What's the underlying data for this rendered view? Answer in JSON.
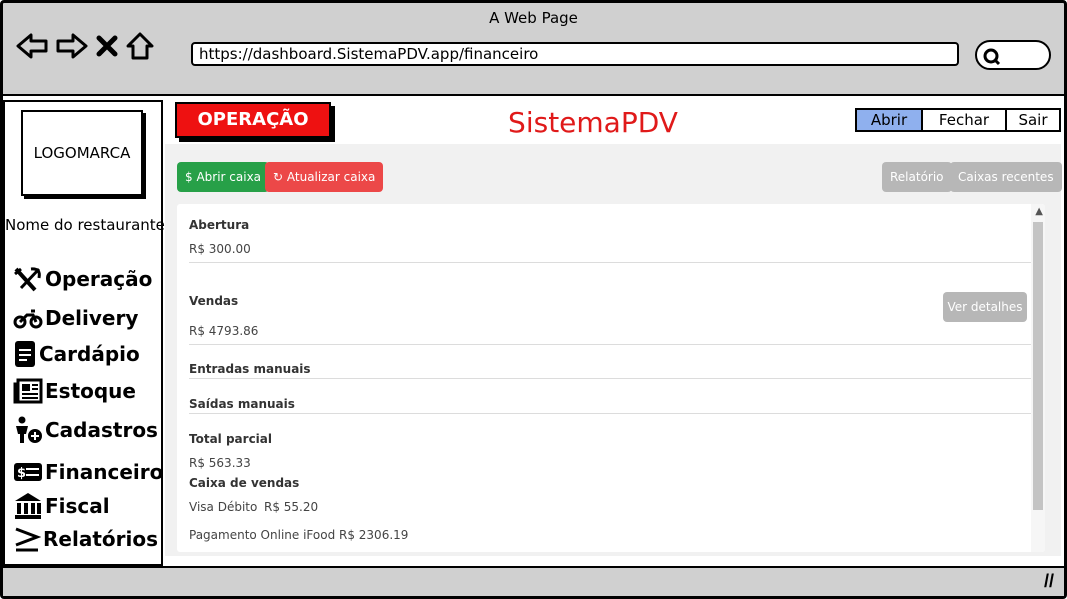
{
  "browser": {
    "title": "A Web Page",
    "url": "https://dashboard.SistemaPDV.app/financeiro"
  },
  "sidebar": {
    "logo": "LOGOMARCA",
    "restaurant_name": "Nome do restaurante",
    "items": [
      {
        "label": "Operação",
        "icon": "utensils-icon"
      },
      {
        "label": "Delivery",
        "icon": "motorcycle-icon"
      },
      {
        "label": "Cardápio",
        "icon": "document-icon"
      },
      {
        "label": "Estoque",
        "icon": "newspaper-icon"
      },
      {
        "label": "Cadastros",
        "icon": "person-add-icon"
      },
      {
        "label": "Financeiro",
        "icon": "money-icon"
      },
      {
        "label": "Fiscal",
        "icon": "bank-icon"
      },
      {
        "label": "Relatórios",
        "icon": "greater-equal-icon"
      }
    ]
  },
  "header": {
    "badge": "OPERAÇÃO",
    "brand": "SistemaPDV",
    "brand_color": "#e01a1a",
    "segments": [
      "Abrir",
      "Fechar",
      "Sair"
    ]
  },
  "toolbar": {
    "open_cash": "$ Abrir caixa",
    "refresh_cash": "Atualizar caixa",
    "report": "Relatório",
    "recent": "Caixas recentes"
  },
  "summary": {
    "opening_title": "Abertura",
    "opening_value": "R$ 300.00",
    "sales_title": "Vendas",
    "sales_value": "R$ 4793.86",
    "details_button": "Ver detalhes",
    "manual_in_title": "Entradas manuais",
    "manual_out_title": "Saídas manuais",
    "partial_title": "Total parcial",
    "partial_value": "R$ 563.33",
    "sales_box_title": "Caixa de vendas",
    "payments": [
      {
        "method": "Visa Débito",
        "amount": "R$ 55.20"
      },
      {
        "method": "Pagamento Online iFood",
        "amount": "R$ 2306.19"
      }
    ]
  },
  "colors": {
    "green": "#27a048",
    "red": "#ec4848",
    "gray": "#b7b7b7",
    "active_segment": "#8fb0ee"
  }
}
